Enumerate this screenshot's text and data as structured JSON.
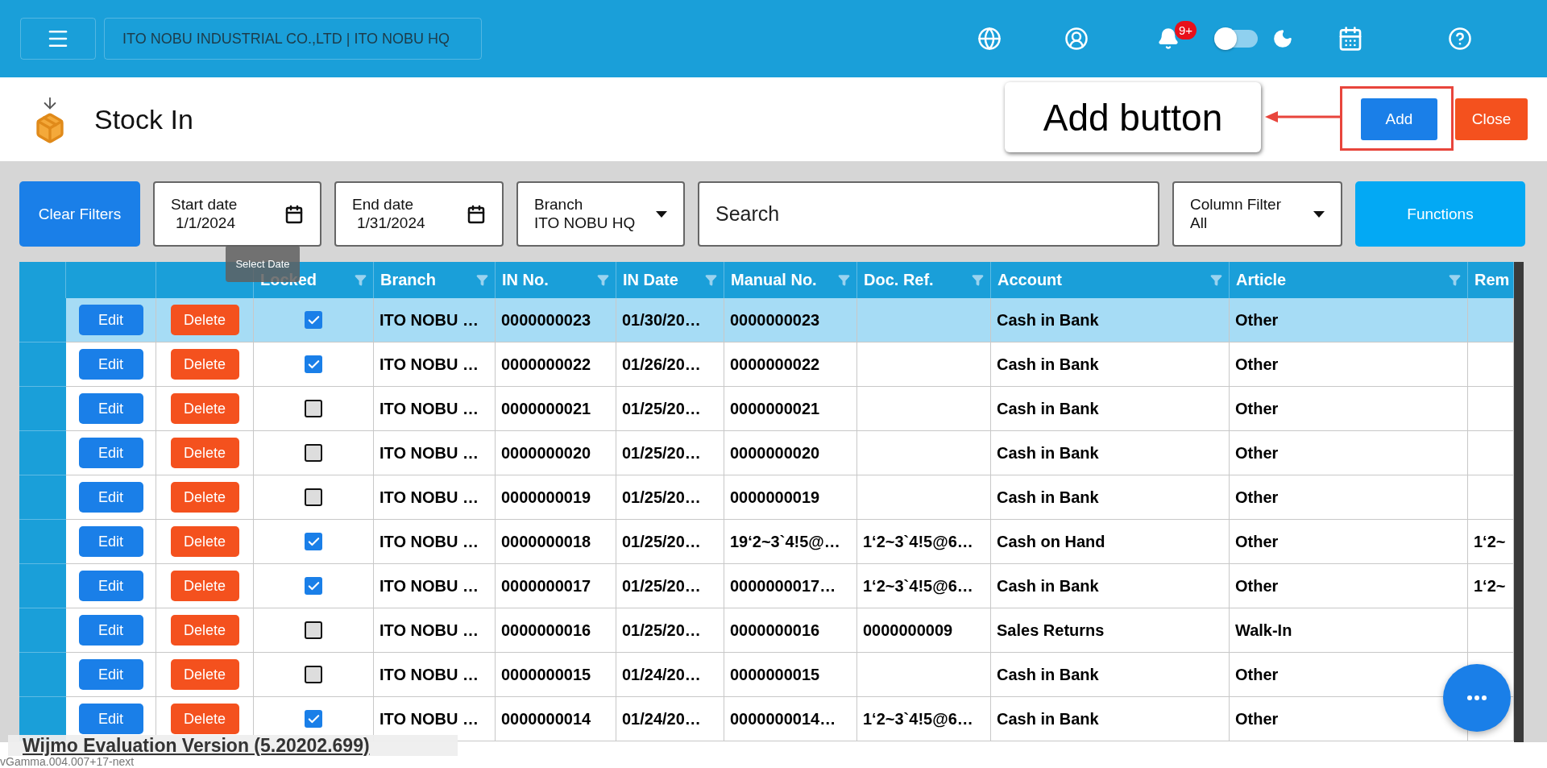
{
  "top_bar": {
    "company": "ITO NOBU INDUSTRIAL CO.,LTD | ITO NOBU HQ",
    "notification_count": "9+",
    "dark_mode": false
  },
  "page": {
    "title": "Stock In",
    "add": "Add",
    "close": "Close"
  },
  "annotation": {
    "callout": "Add button"
  },
  "filters": {
    "clear": "Clear Filters",
    "start_date": {
      "label": "Start date",
      "value": "1/1/2024"
    },
    "end_date": {
      "label": "End date",
      "value": "1/31/2024"
    },
    "branch": {
      "label": "Branch",
      "value": "ITO NOBU HQ"
    },
    "search": {
      "placeholder": "Search"
    },
    "column_filter": {
      "label": "Column Filter",
      "value": "All"
    },
    "functions": "Functions"
  },
  "tooltip": "Select Date",
  "table": {
    "columns": [
      "Locked",
      "Branch",
      "IN No.",
      "IN Date",
      "Manual No.",
      "Doc. Ref.",
      "Account",
      "Article",
      "Rem"
    ],
    "rows": [
      {
        "selected": true,
        "locked": true,
        "edit": "Edit",
        "delete": "Delete",
        "branch": "ITO NOBU …",
        "in_no": "0000000023",
        "in_date": "01/30/20…",
        "manual_no": "0000000023",
        "account": "Cash in Bank",
        "article": "Other"
      },
      {
        "selected": false,
        "locked": true,
        "edit": "Edit",
        "delete": "Delete",
        "branch": "ITO NOBU …",
        "in_no": "0000000022",
        "in_date": "01/26/20…",
        "manual_no": "0000000022",
        "account": "Cash in Bank",
        "article": "Other"
      },
      {
        "selected": false,
        "locked": false,
        "edit": "Edit",
        "delete": "Delete",
        "branch": "ITO NOBU …",
        "in_no": "0000000021",
        "in_date": "01/25/20…",
        "manual_no": "0000000021",
        "account": "Cash in Bank",
        "article": "Other"
      },
      {
        "selected": false,
        "locked": false,
        "edit": "Edit",
        "delete": "Delete",
        "branch": "ITO NOBU …",
        "in_no": "0000000020",
        "in_date": "01/25/20…",
        "manual_no": "0000000020",
        "account": "Cash in Bank",
        "article": "Other"
      },
      {
        "selected": false,
        "locked": false,
        "edit": "Edit",
        "delete": "Delete",
        "branch": "ITO NOBU …",
        "in_no": "0000000019",
        "in_date": "01/25/20…",
        "manual_no": "0000000019",
        "account": "Cash in Bank",
        "article": "Other"
      },
      {
        "selected": false,
        "locked": true,
        "edit": "Edit",
        "delete": "Delete",
        "branch": "ITO NOBU …",
        "in_no": "0000000018",
        "in_date": "01/25/20…",
        "manual_no": "19‘2~3`4!5@…",
        "doc_ref": "1‘2~3`4!5@6…",
        "account": "Cash on Hand",
        "article": "Other",
        "remarks": "1‘2~"
      },
      {
        "selected": false,
        "locked": true,
        "edit": "Edit",
        "delete": "Delete",
        "branch": "ITO NOBU …",
        "in_no": "0000000017",
        "in_date": "01/25/20…",
        "manual_no": "0000000017…",
        "doc_ref": "1‘2~3`4!5@6…",
        "account": "Cash in Bank",
        "article": "Other",
        "remarks": "1‘2~"
      },
      {
        "selected": false,
        "locked": false,
        "edit": "Edit",
        "delete": "Delete",
        "branch": "ITO NOBU …",
        "in_no": "0000000016",
        "in_date": "01/25/20…",
        "manual_no": "0000000016",
        "doc_ref": "0000000009",
        "account": "Sales Returns",
        "article": "Walk-In"
      },
      {
        "selected": false,
        "locked": false,
        "edit": "Edit",
        "delete": "Delete",
        "branch": "ITO NOBU …",
        "in_no": "0000000015",
        "in_date": "01/24/20…",
        "manual_no": "0000000015",
        "account": "Cash in Bank",
        "article": "Other"
      },
      {
        "selected": false,
        "locked": true,
        "edit": "Edit",
        "delete": "Delete",
        "branch": "ITO NOBU …",
        "in_no": "0000000014",
        "in_date": "01/24/20…",
        "manual_no": "0000000014…",
        "doc_ref": "1‘2~3`4!5@6…",
        "account": "Cash in Bank",
        "article": "Other"
      }
    ]
  },
  "evaluation_banner": "Wijmo Evaluation Version (5.20202.699)",
  "version": "vGamma.004.007+17-next"
}
